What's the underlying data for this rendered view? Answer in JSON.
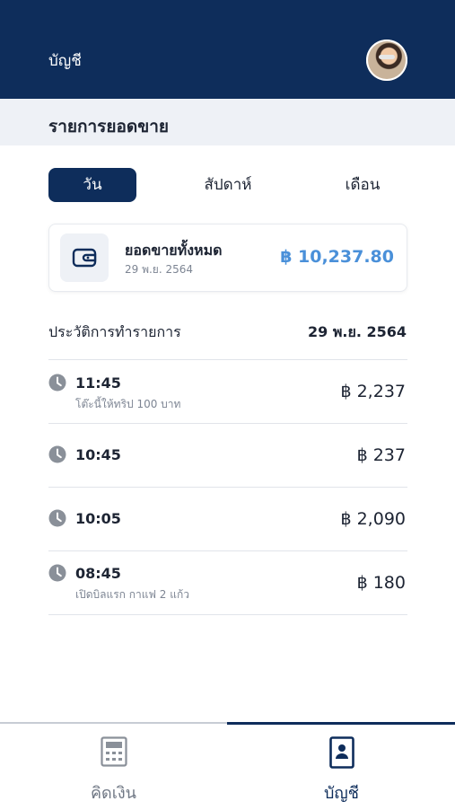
{
  "header": {
    "title": "บัญชี",
    "avatar_icon": "user-avatar"
  },
  "section": {
    "title": "รายการยอดขาย"
  },
  "tabs": [
    {
      "label": "วัน",
      "active": true
    },
    {
      "label": "สัปดาห์",
      "active": false
    },
    {
      "label": "เดือน",
      "active": false
    }
  ],
  "summary": {
    "label": "ยอดขายทั้งหมด",
    "date": "29 พ.ย. 2564",
    "amount": "฿ 10,237.80",
    "icon": "wallet-icon"
  },
  "history": {
    "label": "ประวัติการทำรายการ",
    "date": "29 พ.ย. 2564",
    "items": [
      {
        "time": "11:45",
        "note": "โต๊ะนี้ให้ทริป 100 บาท",
        "amount": "฿ 2,237"
      },
      {
        "time": "10:45",
        "note": "",
        "amount": "฿ 237"
      },
      {
        "time": "10:05",
        "note": "",
        "amount": "฿ 2,090"
      },
      {
        "time": "08:45",
        "note": "เปิดบิลแรก กาแฟ  2 แก้ว",
        "amount": "฿ 180"
      }
    ]
  },
  "bottom_nav": [
    {
      "label": "คิดเงิน",
      "icon": "calculator-icon",
      "active": false
    },
    {
      "label": "บัญชี",
      "icon": "account-book-icon",
      "active": true
    }
  ],
  "colors": {
    "primary": "#0e2d5b",
    "accent": "#4a90d9",
    "muted": "#7d8593",
    "band": "#eef1f6"
  }
}
